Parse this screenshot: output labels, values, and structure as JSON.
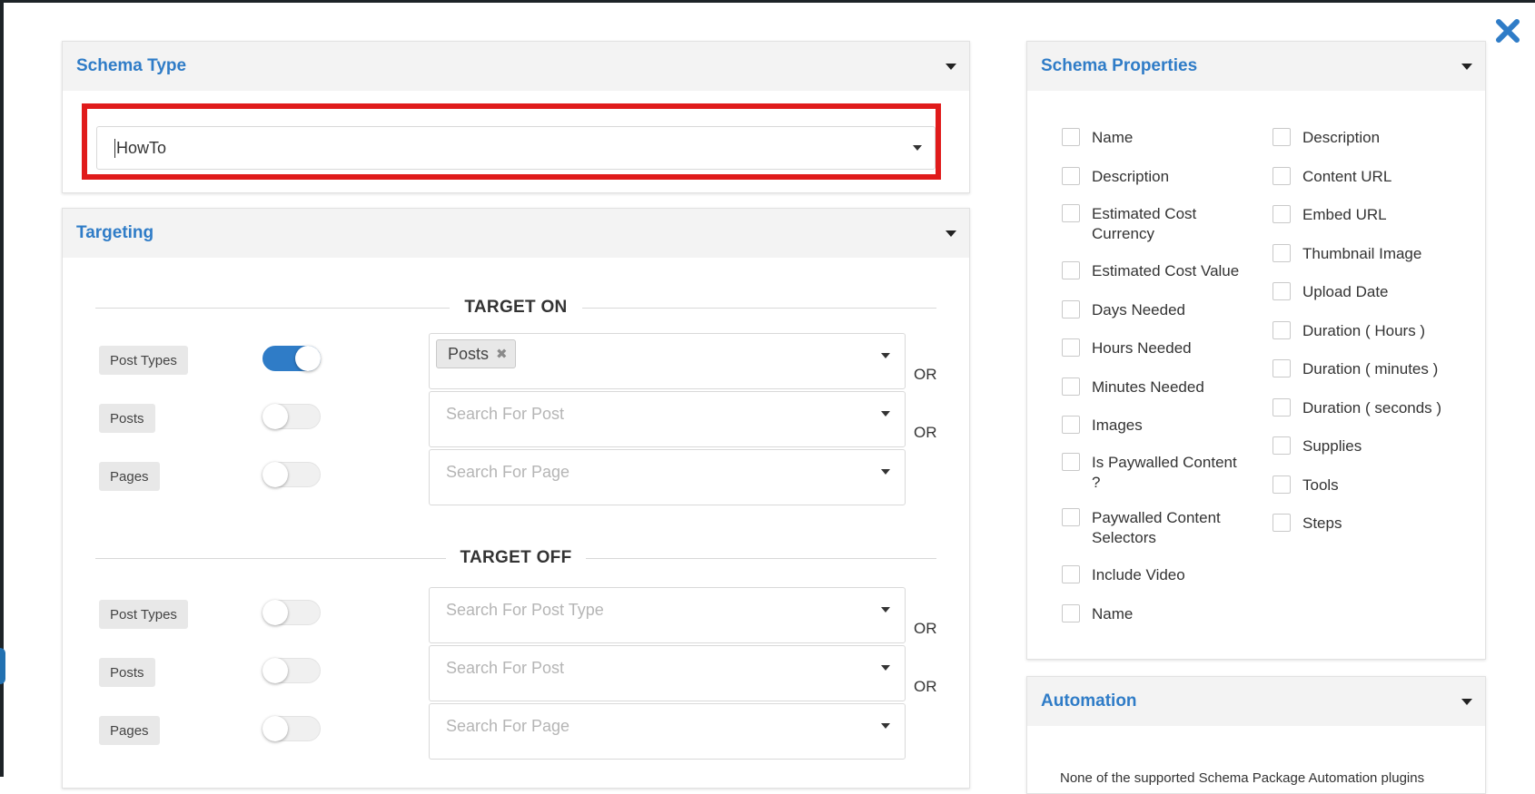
{
  "schema_type": {
    "title": "Schema Type",
    "selected": "HowTo"
  },
  "targeting": {
    "title": "Targeting",
    "target_on": {
      "heading": "TARGET ON",
      "rows": [
        {
          "label": "Post Types",
          "toggle_on": true,
          "chip": "Posts",
          "placeholder": "",
          "suffix": "OR"
        },
        {
          "label": "Posts",
          "toggle_on": false,
          "chip": "",
          "placeholder": "Search For Post",
          "suffix": "OR"
        },
        {
          "label": "Pages",
          "toggle_on": false,
          "chip": "",
          "placeholder": "Search For Page",
          "suffix": ""
        }
      ]
    },
    "target_off": {
      "heading": "TARGET OFF",
      "rows": [
        {
          "label": "Post Types",
          "toggle_on": false,
          "placeholder": "Search For Post Type",
          "suffix": "OR"
        },
        {
          "label": "Posts",
          "toggle_on": false,
          "placeholder": "Search For Post",
          "suffix": "OR"
        },
        {
          "label": "Pages",
          "toggle_on": false,
          "placeholder": "Search For Page",
          "suffix": ""
        }
      ]
    }
  },
  "schema_properties": {
    "title": "Schema Properties",
    "left_column": [
      "Name",
      "Description",
      "Estimated Cost Currency",
      "Estimated Cost Value",
      "Days Needed",
      "Hours Needed",
      "Minutes Needed",
      "Images",
      "Is Paywalled Content ?",
      "Paywalled Content Selectors",
      "Include Video",
      "Name"
    ],
    "right_column": [
      "Description",
      "Content URL",
      "Embed URL",
      "Thumbnail Image",
      "Upload Date",
      "Duration ( Hours )",
      "Duration ( minutes )",
      "Duration ( seconds )",
      "Supplies",
      "Tools",
      "Steps"
    ]
  },
  "automation": {
    "title": "Automation",
    "text": "None of the supported Schema Package Automation plugins"
  },
  "colors": {
    "accent": "#2f7cc7",
    "highlight": "#e01b1b"
  }
}
